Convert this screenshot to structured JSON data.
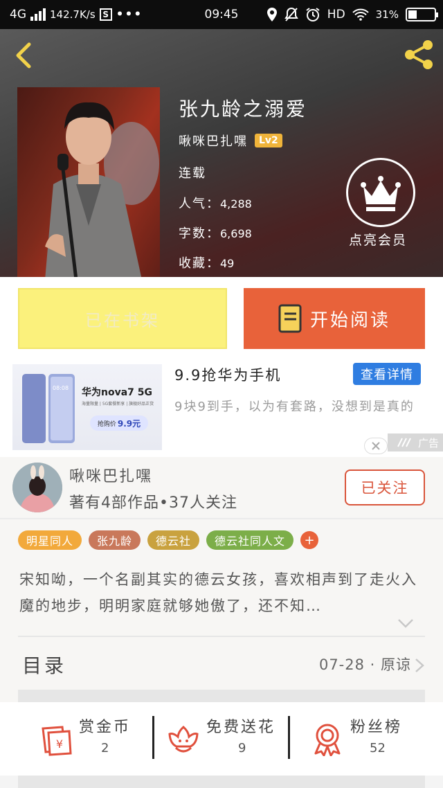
{
  "status_bar": {
    "network": "4G",
    "speed": "142.7K/s",
    "s_icon": "S",
    "dots": "•••",
    "time": "09:45",
    "hd": "HD",
    "battery": "31%"
  },
  "book": {
    "title": "张九龄之溺爱",
    "author": "啾咪巴扎嘿",
    "level": "Lv2",
    "status": "连载",
    "popularity_label": "人气：",
    "popularity": "4,288",
    "words_label": "字数：",
    "words": "6,698",
    "favorites_label": "收藏：",
    "favorites": "49",
    "vip_label": "点亮会员"
  },
  "actions": {
    "shelf_label": "已在书架",
    "read_label": "开始阅读"
  },
  "ad": {
    "title": "9.9抢华为手机",
    "detail_label": "查看详情",
    "description": "9块9到手，以为有套路，没想到是真的",
    "tag": "广告",
    "phone_brand": "华为nova7 5G",
    "promo_line": "海量限量 | 5G套餐新享 | 旗舰好品正货",
    "price_label": "抢购价",
    "price": "9.9元",
    "phone_time": "08:08"
  },
  "author_card": {
    "name": "啾咪巴扎嘿",
    "meta": "著有4部作品•37人关注",
    "follow_label": "已关注",
    "tags": [
      {
        "label": "明星同人",
        "color": "#f2a93b"
      },
      {
        "label": "张九龄",
        "color": "#c9785b"
      },
      {
        "label": "德云社",
        "color": "#c9a23f"
      },
      {
        "label": "德云社同人文",
        "color": "#7cae49"
      }
    ],
    "tag_add": "+",
    "synopsis": "宋知呦，一个名副其实的德云女孩，喜欢相声到了走火入魔的地步，明明家庭就够她傲了，还不知…",
    "toc_label": "目录",
    "toc_meta": "07-28 · 原谅"
  },
  "bottom_stats": [
    {
      "label": "赏金币",
      "value": "2",
      "icon": "coin-envelope-icon"
    },
    {
      "label": "免费送花",
      "value": "9",
      "icon": "flower-icon"
    },
    {
      "label": "粉丝榜",
      "value": "52",
      "icon": "award-medal-icon"
    }
  ]
}
